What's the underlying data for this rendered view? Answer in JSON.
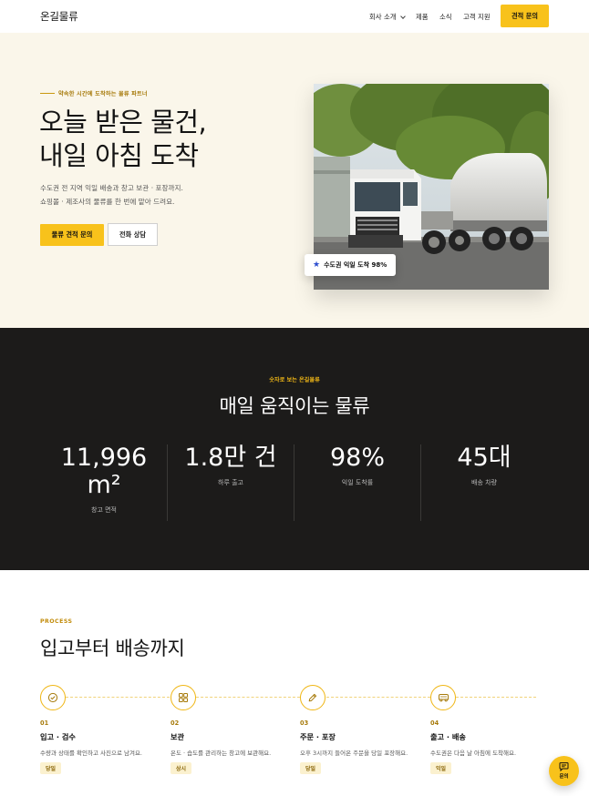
{
  "header": {
    "logo": "온길물류",
    "nav": [
      "회사 소개",
      "제품",
      "소식",
      "고객 지원"
    ],
    "cta": "견적 문의"
  },
  "hero": {
    "eyebrow": "약속한 시간에 도착하는 물류 파트너",
    "title_line1": "오늘 받은 물건,",
    "title_line2": "내일 아침 도착",
    "desc_line1": "수도권 전 지역 익일 배송과 창고 보관 · 포장까지.",
    "desc_line2": "쇼핑몰 · 제조사의 물류를 한 번에 맡아 드려요.",
    "primary_button": "물류 견적 문의",
    "secondary_button": "전화 상담",
    "badge": "수도권 익일 도착 98%"
  },
  "stats": {
    "eyebrow": "숫자로 보는 온길물류",
    "title": "매일 움직이는 물류",
    "items": [
      {
        "value_line1": "11,996",
        "value_line2": "m²",
        "label": "창고 면적"
      },
      {
        "value_line1": "1.8만 건",
        "value_line2": "",
        "label": "하루 출고"
      },
      {
        "value_line1": "98%",
        "value_line2": "",
        "label": "익일 도착률"
      },
      {
        "value_line1": "45대",
        "value_line2": "",
        "label": "배송 차량"
      }
    ]
  },
  "process": {
    "eyebrow": "PROCESS",
    "title": "입고부터 배송까지",
    "steps": [
      {
        "num": "01",
        "title": "입고 · 검수",
        "desc": "수량과 상태를 확인하고 사진으로 남겨요.",
        "tag": "당일",
        "icon": "check-circle-icon"
      },
      {
        "num": "02",
        "title": "보관",
        "desc": "온도 · 습도를 관리하는 창고에 보관해요.",
        "tag": "상시",
        "icon": "grid-icon"
      },
      {
        "num": "03",
        "title": "주문 · 포장",
        "desc": "오후 3시까지 들어온 주문을 당일 포장해요.",
        "tag": "당일",
        "icon": "pencil-icon"
      },
      {
        "num": "04",
        "title": "출고 · 배송",
        "desc": "수도권은 다음 날 아침에 도착해요.",
        "tag": "익일",
        "icon": "truck-icon"
      }
    ]
  },
  "fab": {
    "label": "문의"
  },
  "colors": {
    "accent": "#f8c21b",
    "dark": "#1c1b1a",
    "cream": "#faf6ea"
  }
}
